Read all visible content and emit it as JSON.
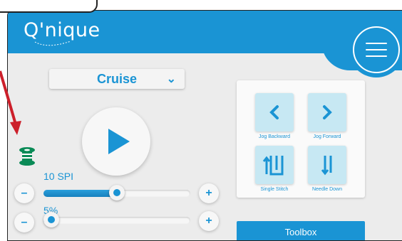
{
  "header": {
    "logo_text": "Q'nique",
    "menu_icon": "hamburger-menu-icon"
  },
  "mode_dropdown": {
    "selected": "Cruise"
  },
  "play_button": {
    "icon": "play-icon"
  },
  "stitch_slider": {
    "label": "10 SPI",
    "value_fraction": 0.5
  },
  "speed_slider": {
    "label": "5%",
    "value_fraction": 0.05
  },
  "controls": {
    "minus": "–",
    "plus": "+"
  },
  "jog_pad": {
    "jog_backward": "Jog Backward",
    "jog_forward": "Jog Forward",
    "single_stitch": "Single Stitch",
    "needle_down": "Needle Down"
  },
  "toolbox": {
    "label": "Toolbox"
  },
  "colors": {
    "accent": "#1a94d4",
    "pad": "#c7e8f3",
    "bobbin": "#0a8a56",
    "arrow": "#cc1f2a"
  }
}
